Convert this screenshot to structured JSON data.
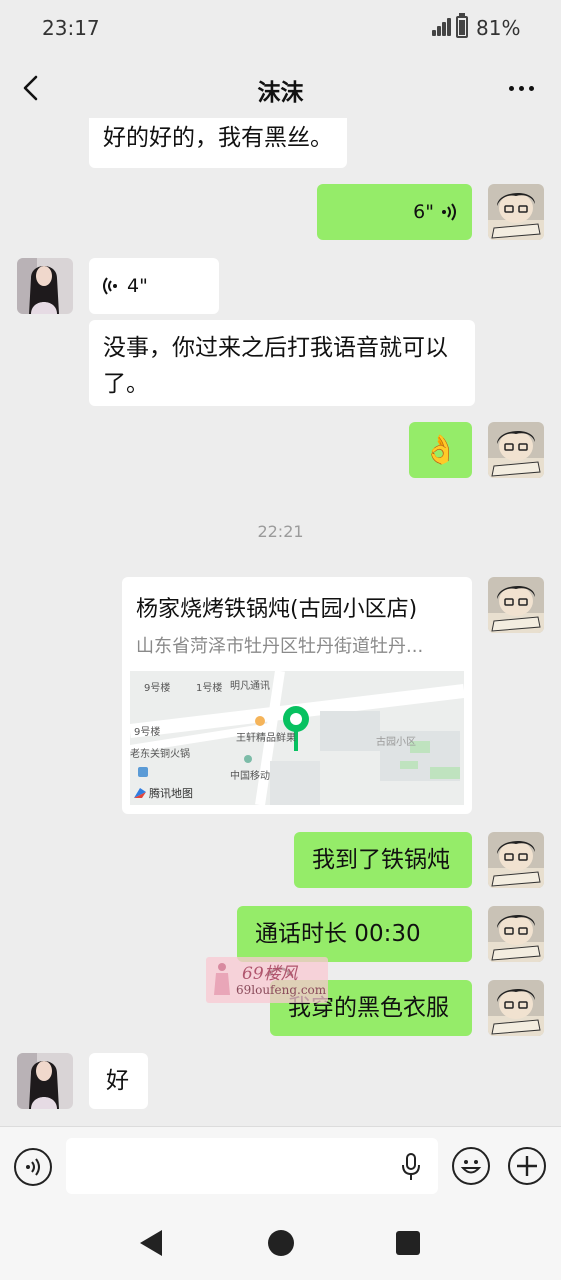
{
  "status_bar": {
    "time": "23:17",
    "battery": "81%",
    "battery_level": 0.81
  },
  "header": {
    "title": "沫沫"
  },
  "messages": [
    {
      "type": "text",
      "side": "in",
      "text": "好的好的，我有黑丝。"
    },
    {
      "type": "voice",
      "side": "out",
      "duration": "6\""
    },
    {
      "type": "voice",
      "side": "in",
      "duration": "4\""
    },
    {
      "type": "text",
      "side": "in",
      "line1": "没事，你过来之后打我语音就可以",
      "line2": "了。"
    },
    {
      "type": "emoji",
      "side": "out",
      "emoji": "👌"
    },
    {
      "type": "time",
      "text": "22:21"
    },
    {
      "type": "location",
      "side": "out",
      "name": "杨家烧烤铁锅炖(古园小区店)",
      "address": "山东省菏泽市牡丹区牡丹街道牡丹...",
      "map_labels": [
        "9号楼",
        "1号楼",
        "明凡通讯",
        "王轩精品鲜果",
        "古园小区",
        "9号楼",
        "老东关铜火锅",
        "中国移动"
      ],
      "map_brand": "腾讯地图"
    },
    {
      "type": "text",
      "side": "out",
      "text": "我到了铁锅炖"
    },
    {
      "type": "call",
      "side": "out",
      "text": "通话时长 00:30"
    },
    {
      "type": "text",
      "side": "out",
      "text": "我穿的黑色衣服"
    },
    {
      "type": "text",
      "side": "in",
      "text": "好"
    }
  ],
  "watermark": {
    "title": "69楼风",
    "url": "69loufeng.com"
  },
  "icons": {
    "back": "chevron-left-icon",
    "more": "more-icon",
    "voice": "voice-icon",
    "mic": "mic-icon",
    "emoji": "emoji-icon",
    "plus": "plus-icon"
  },
  "colors": {
    "outgoing_bubble": "#95ec69",
    "incoming_bubble": "#ffffff",
    "background": "#ededed"
  }
}
